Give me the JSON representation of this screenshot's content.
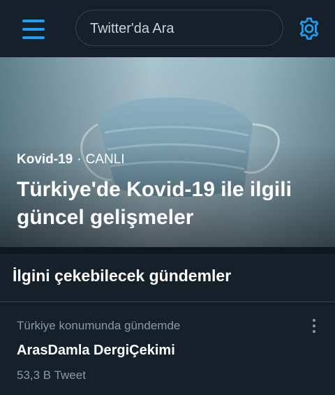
{
  "header": {
    "search_placeholder": "Twitter'da Ara",
    "menu_icon": "hamburger-menu-icon",
    "settings_icon": "gear-icon"
  },
  "hero": {
    "topic": "Kovid-19",
    "separator": "·",
    "status": "CANLI",
    "title": "Türkiye'de Kovid-19 ile ilgili güncel gelişmeler"
  },
  "section": {
    "title": "İlgini çekebilecek gündemler"
  },
  "trends": [
    {
      "context": "Türkiye konumunda gündemde",
      "name": "ArasDamla DergiÇekimi",
      "count": "53,3 B Tweet"
    }
  ],
  "colors": {
    "background": "#15202b",
    "accent": "#1da1f2",
    "muted_text": "#8899a6",
    "border": "#38444d"
  }
}
